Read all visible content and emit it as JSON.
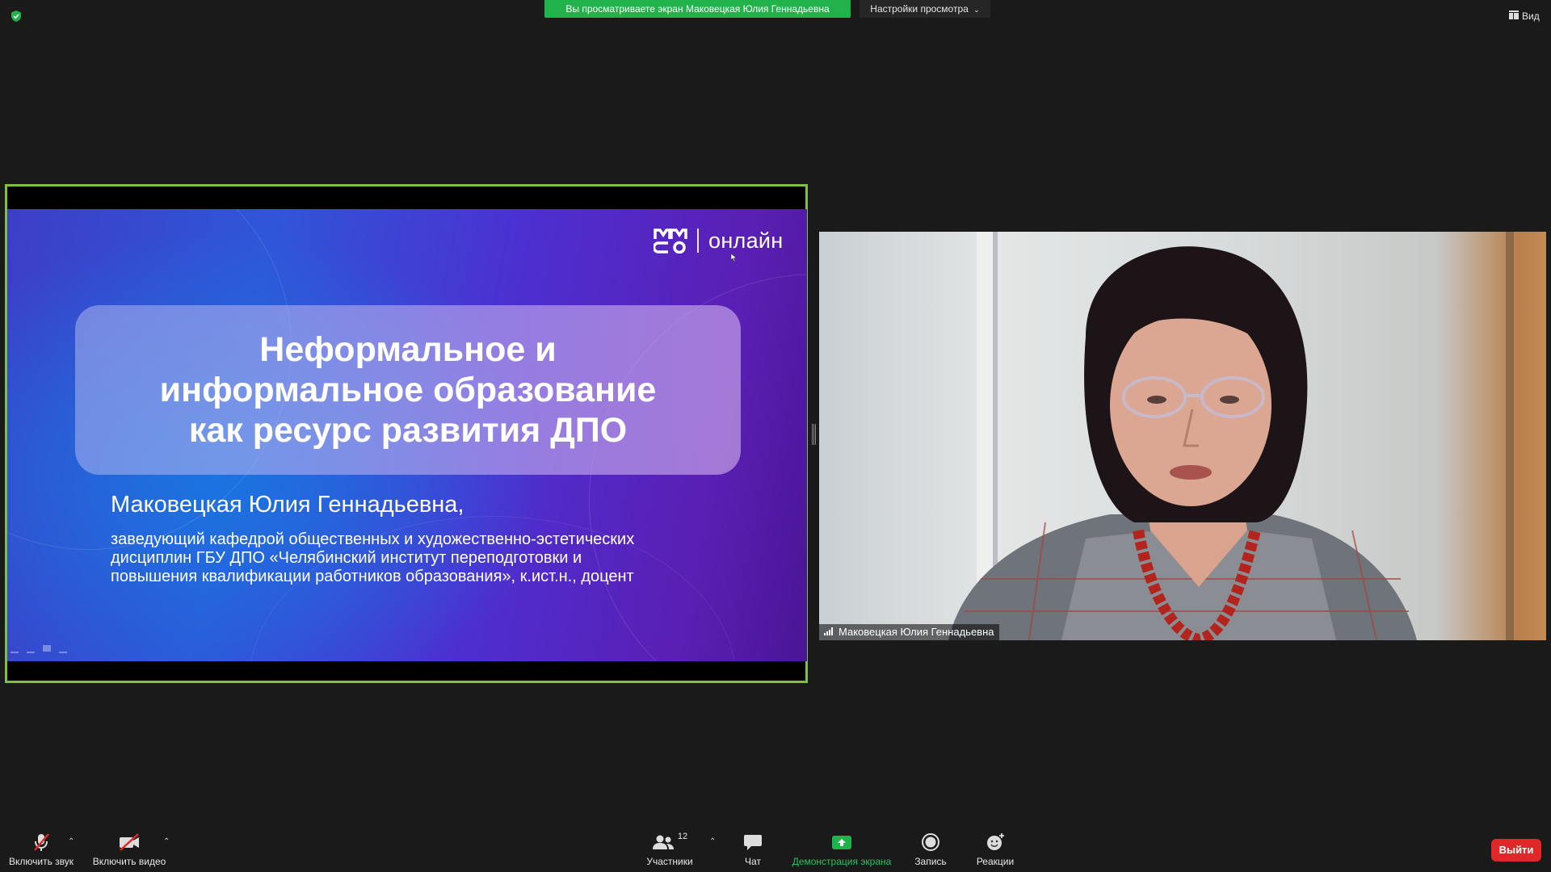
{
  "top": {
    "share_banner": "Вы просматриваете экран Маковецкая Юлия Геннадьевна",
    "view_options": "Настройки просмотра",
    "view_button": "Вид"
  },
  "slide": {
    "logo_text": "онлайн",
    "title": "Неформальное и\nинформальное образование\nкак ресурс развития ДПО",
    "speaker_name": "Маковецкая Юлия Геннадьевна,",
    "speaker_desc": "заведующий кафедрой общественных и художественно-эстетических\nдисциплин ГБУ ДПО «Челябинский институт переподготовки и\nповышения квалификации работников образования», к.ист.н., доцент"
  },
  "video": {
    "participant_name": "Маковецкая Юлия Геннадьевна"
  },
  "toolbar": {
    "mute_label": "Включить звук",
    "video_label": "Включить видео",
    "participants_label": "Участники",
    "participants_count": "12",
    "chat_label": "Чат",
    "share_label": "Демонстрация экрана",
    "record_label": "Запись",
    "reactions_label": "Реакции",
    "exit_label": "Выйти"
  },
  "colors": {
    "share_banner": "#22b24c",
    "share_border": "#7bc142",
    "exit": "#e02828",
    "background": "#1a1a1a"
  }
}
